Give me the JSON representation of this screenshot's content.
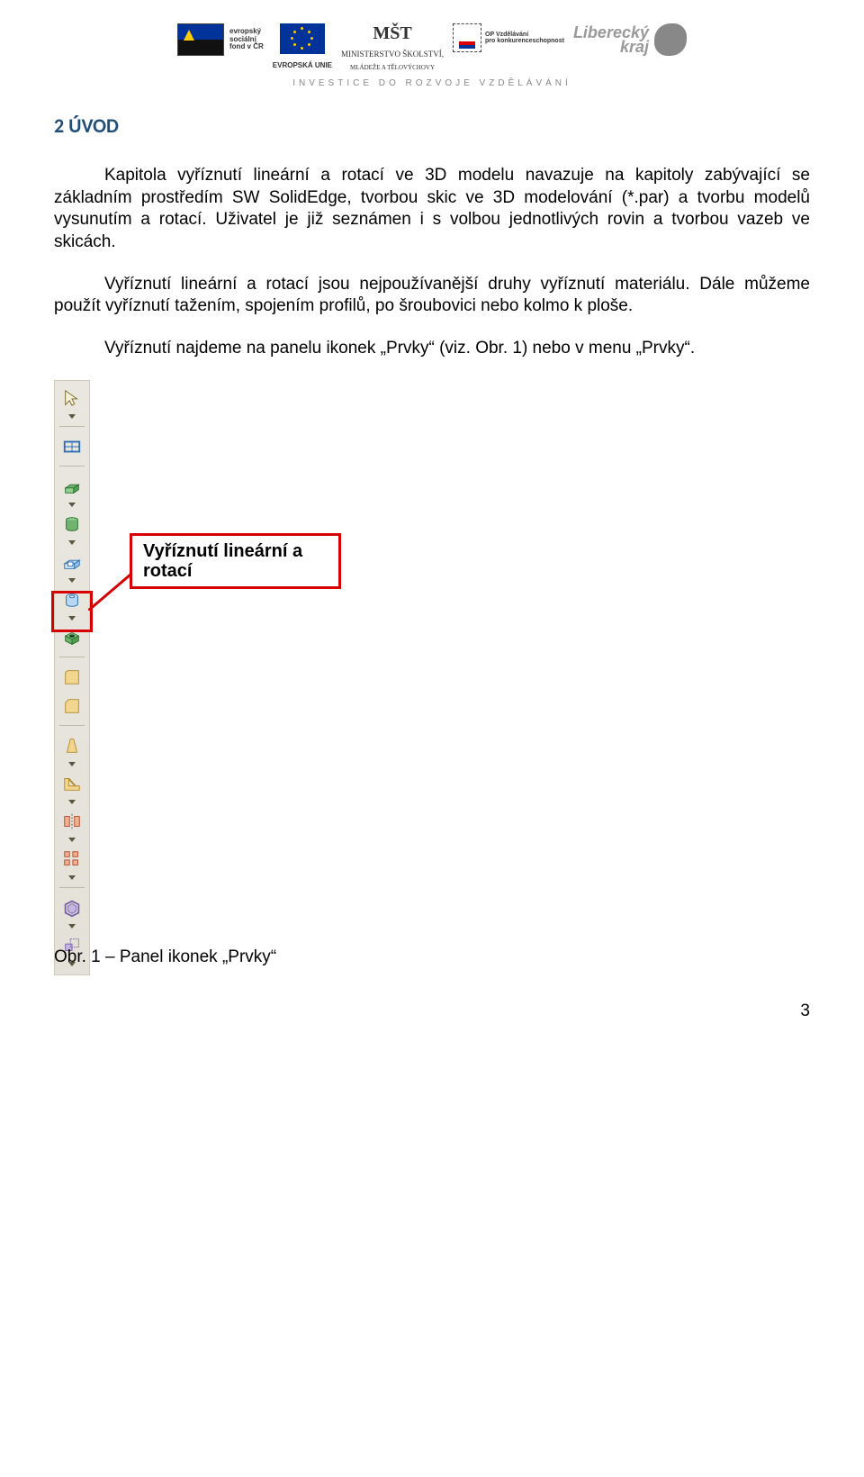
{
  "header": {
    "logos": {
      "esf_lines": [
        "evropský",
        "sociální",
        "fond v ČR"
      ],
      "eu_label": "EVROPSKÁ UNIE",
      "msmt_glyph": "MŠT",
      "msmt_line1": "MINISTERSTVO ŠKOLSTVÍ,",
      "msmt_line2": "MLÁDEŽE A TĚLOVÝCHOVY",
      "op_line1": "OP Vzdělávání",
      "op_line2": "pro konkurenceschopnost",
      "lk_line1": "Liberecký",
      "lk_line2": "kraj"
    },
    "tagline": "INVESTICE DO ROZVOJE VZDĚLÁVÁNÍ"
  },
  "section_title": "2 ÚVOD",
  "paragraphs": {
    "p1": "Kapitola vyříznutí lineární a rotací ve 3D modelu navazuje na kapitoly zabývající se základním prostředím SW SolidEdge, tvorbou skic ve 3D modelování (*.par) a tvorbu modelů vysunutím a rotací. Uživatel je již seznámen i s volbou jednotlivých rovin a tvorbou vazeb ve skicách.",
    "p2": "Vyříznutí lineární a rotací jsou nejpoužívanější druhy vyříznutí materiálu. Dále můžeme použít vyříznutí tažením, spojením profilů, po šroubovici nebo kolmo k ploše.",
    "p3": "Vyříznutí najdeme na panelu ikonek „Prvky“ (viz. Obr. 1) nebo v menu „Prvky“."
  },
  "callout_label_l1": "Vyříznutí lineární a",
  "callout_label_l2": "rotací",
  "toolbar_icons": [
    "select-arrow-icon",
    "sketch-icon",
    "extrude-icon",
    "revolve-icon",
    "cut-extrude-icon",
    "cut-revolve-icon",
    "hole-icon",
    "round-icon",
    "chamfer-icon",
    "draft-icon",
    "rib-icon",
    "mirror-icon",
    "pattern-icon",
    "thin-wall-icon",
    "scale-icon"
  ],
  "figure_caption": "Obr. 1 – Panel ikonek „Prvky“",
  "page_number": "3"
}
